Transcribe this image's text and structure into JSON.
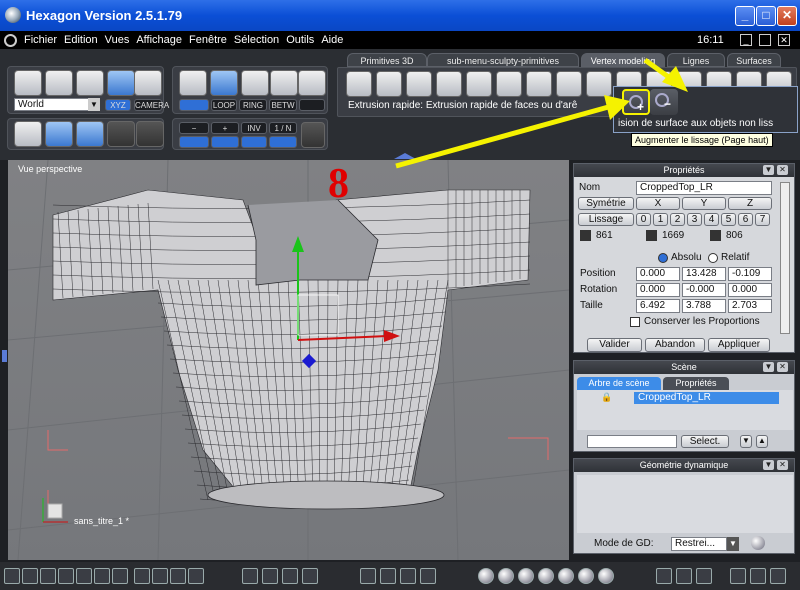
{
  "window": {
    "title": "Hexagon Version 2.5.1.79",
    "time": "16:11"
  },
  "menu": [
    "Fichier",
    "Edition",
    "Vues",
    "Affichage",
    "Fenêtre",
    "Sélection",
    "Outils",
    "Aide"
  ],
  "tabs": [
    "Primitives 3D",
    "sub-menu-sculpty-primitives",
    "Vertex modeling",
    "Lignes",
    "Surfaces"
  ],
  "active_tab": "Vertex modeling",
  "toolbar": {
    "coord_select": "World",
    "xyz": "XYZ",
    "camera": "CAMERA",
    "loop": "LOOP",
    "ring": "RING",
    "betw": "BETW",
    "minus": "−",
    "plus": "+",
    "inv": "INV",
    "one_n": "1 / N",
    "status_line": "Extrusion rapide: Extrusion rapide de faces ou d'arê",
    "submenu_text": "ision de surface aux objets non liss",
    "tooltip": "Augmenter le lissage (Page haut)"
  },
  "annotation_number": "8",
  "viewport": {
    "label": "Vue perspective",
    "scene_name": "sans_titre_1 *"
  },
  "properties": {
    "title": "Propriétés",
    "nom_label": "Nom",
    "nom_value": "CroppedTop_LR",
    "symetrie": "Symétrie",
    "x": "X",
    "y": "Y",
    "z": "Z",
    "lissage": "Lissage",
    "lissage_levels": [
      "0",
      "1",
      "2",
      "3",
      "4",
      "5",
      "6",
      "7"
    ],
    "counts": [
      "861",
      "1669",
      "806"
    ],
    "absolu": "Absolu",
    "relatif": "Relatif",
    "rows": [
      {
        "label": "Position",
        "values": [
          "0.000",
          "13.428",
          "-0.109"
        ]
      },
      {
        "label": "Rotation",
        "values": [
          "0.000",
          "-0.000",
          "0.000"
        ]
      },
      {
        "label": "Taille",
        "values": [
          "6.492",
          "3.788",
          "2.703"
        ]
      }
    ],
    "conserver": "Conserver les Proportions",
    "valider": "Valider",
    "abandon": "Abandon",
    "appliquer": "Appliquer"
  },
  "scene": {
    "title": "Scène",
    "tab_tree": "Arbre de scène",
    "tab_props": "Propriétés",
    "item": "CroppedTop_LR",
    "select_btn": "Select."
  },
  "dyn_geo": {
    "title": "Géométrie dynamique",
    "mode_label": "Mode de GD:",
    "mode_value": "Restrei..."
  },
  "colors": {
    "accent_yellow": "#f5f200",
    "annotation_red": "#e00000",
    "selection_blue": "#3d8ce8"
  }
}
